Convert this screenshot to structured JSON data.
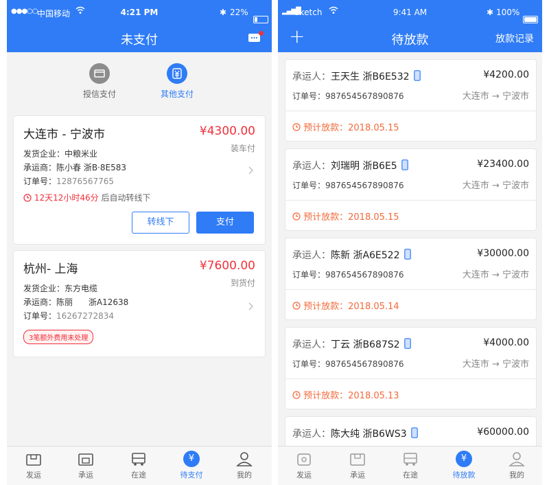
{
  "left": {
    "status": {
      "signal": "●●●○○",
      "carrier": "中国移动",
      "time": "4:21 PM",
      "bluetooth": "✱",
      "battery": "22%"
    },
    "title": "未支付",
    "colors": {
      "accent": "#2f7cf6",
      "red": "#f0303a"
    },
    "segments": [
      {
        "label": "授信支付",
        "icon": "card-icon"
      },
      {
        "label": "其他支付",
        "icon": "yen-icon"
      }
    ],
    "orders": [
      {
        "route": "大连市 - 宁波市",
        "amount": "¥4300.00",
        "pay_type": "装车付",
        "shipper": "发货企业：中粮米业",
        "carrier": "承运商：陈小春  浙B·8E583",
        "order_no_label": "订单号：",
        "order_no": "12876567765",
        "countdown": "12天12小时46分",
        "countdown_suffix": "后自动转线下",
        "btn_offline": "转线下",
        "btn_pay": "支付"
      },
      {
        "route": "杭州- 上海",
        "amount": "¥7600.00",
        "pay_type": "到货付",
        "shipper": "发货企业：东方电缆",
        "carrier": "承运商：陈丽      浙A12638",
        "order_no_label": "订单号：",
        "order_no": "16267272834",
        "badge": "3笔额外费用未处理"
      }
    ],
    "tabs": [
      "发运",
      "承运",
      "在途",
      "待支付",
      "我的"
    ]
  },
  "right": {
    "status": {
      "signal": "▂▄▆█",
      "carrier": "Sketch",
      "time": "9:41 AM",
      "bluetooth": "✱",
      "battery": "100%"
    },
    "title": "待放款",
    "plus": "+",
    "records": "放款记录",
    "items": [
      {
        "carrier_label": "承运人：",
        "name": "王天生  浙B6E532",
        "amount": "¥4200.00",
        "order_label": "订单号：",
        "order_no": "987654567890876",
        "from": "大连市",
        "arrow": "→",
        "to": "宁波市",
        "expected": "预计放款：2018.05.15"
      },
      {
        "carrier_label": "承运人：",
        "name": "刘瑞明  浙B6E5",
        "amount": "¥23400.00",
        "order_label": "订单号：",
        "order_no": "987654567890876",
        "from": "大连市",
        "arrow": "→",
        "to": "宁波市",
        "expected": "预计放款：2018.05.15"
      },
      {
        "carrier_label": "承运人：",
        "name": "陈新  浙A6E522",
        "amount": "¥30000.00",
        "order_label": "订单号：",
        "order_no": "987654567890876",
        "from": "大连市",
        "arrow": "→",
        "to": "宁波市",
        "expected": "预计放款：2018.05.14"
      },
      {
        "carrier_label": "承运人：",
        "name": "丁云  浙B687S2",
        "amount": "¥4000.00",
        "order_label": "订单号：",
        "order_no": "987654567890876",
        "from": "大连市",
        "arrow": "→",
        "to": "宁波市",
        "expected": "预计放款：2018.05.13"
      },
      {
        "carrier_label": "承运人：",
        "name": "陈大纯  浙B6WS3",
        "amount": "¥60000.00"
      }
    ],
    "tabs": [
      "发运",
      "承运",
      "在途",
      "待放款",
      "我的"
    ]
  }
}
